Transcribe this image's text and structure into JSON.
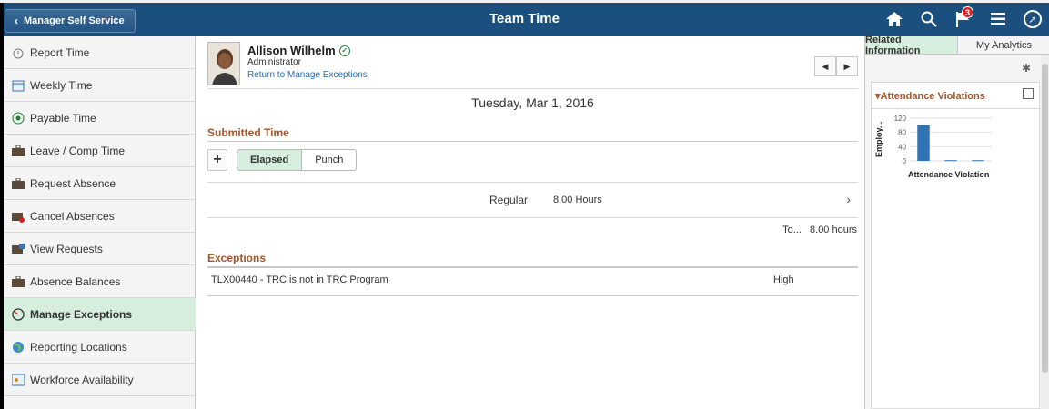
{
  "header": {
    "back_label": "Manager Self Service",
    "title": "Team Time",
    "notification_count": "3",
    "icons": [
      "home-icon",
      "search-icon",
      "flag-icon",
      "menu-icon",
      "navbar-compass-icon"
    ]
  },
  "nav": {
    "items": [
      {
        "label": "Report Time",
        "icon": "clock-icon"
      },
      {
        "label": "Weekly Time",
        "icon": "calendar-icon"
      },
      {
        "label": "Payable Time",
        "icon": "payable-icon"
      },
      {
        "label": "Leave / Comp Time",
        "icon": "briefcase-icon"
      },
      {
        "label": "Request Absence",
        "icon": "briefcase-icon"
      },
      {
        "label": "Cancel Absences",
        "icon": "briefcase-cancel-icon"
      },
      {
        "label": "View Requests",
        "icon": "briefcase-view-icon"
      },
      {
        "label": "Absence Balances",
        "icon": "briefcase-icon"
      },
      {
        "label": "Manage Exceptions",
        "icon": "exceptions-icon"
      },
      {
        "label": "Reporting Locations",
        "icon": "globe-icon"
      },
      {
        "label": "Workforce Availability",
        "icon": "workforce-icon"
      }
    ],
    "active_label": "Manage Exceptions"
  },
  "person": {
    "name": "Allison Wilhelm",
    "role": "Administrator",
    "return_link": "Return to Manage Exceptions"
  },
  "main": {
    "date": "Tuesday, Mar 1, 2016",
    "submitted_title": "Submitted Time",
    "seg_elapsed": "Elapsed",
    "seg_punch": "Punch",
    "regular_label": "Regular",
    "regular_value": "8.00 Hours",
    "total_label": "To...",
    "total_value": "8.00 hours",
    "exceptions_title": "Exceptions",
    "exception_text": "TLX00440 - TRC is not in TRC Program",
    "exception_severity": "High"
  },
  "rpanel": {
    "tab_related": "Related Information",
    "tab_analytics": "My Analytics",
    "card_title": "Attendance Violations"
  },
  "chart_data": {
    "type": "bar",
    "title": "Attendance Violations",
    "xlabel": "Attendance Violation",
    "ylabel": "Employ...",
    "ylim": [
      0,
      120
    ],
    "yticks": [
      0,
      40,
      80,
      120
    ],
    "categories": [
      "",
      "",
      ""
    ],
    "values": [
      100,
      2,
      2
    ]
  }
}
